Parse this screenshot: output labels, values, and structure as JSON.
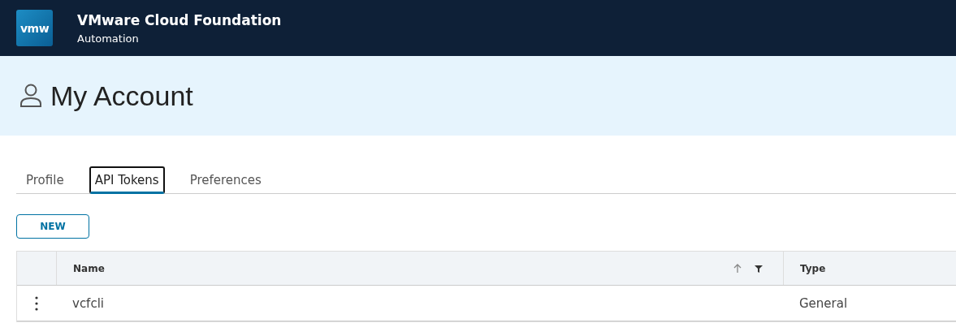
{
  "header": {
    "logo": "vmw",
    "title": "VMware Cloud Foundation",
    "subtitle": "Automation"
  },
  "page": {
    "title": "My Account"
  },
  "tabs": [
    {
      "label": "Profile",
      "selected": false
    },
    {
      "label": "API Tokens",
      "selected": true
    },
    {
      "label": "Preferences",
      "selected": false
    }
  ],
  "new_button": "NEW",
  "table": {
    "columns": [
      {
        "label": "Name",
        "sortable": true
      },
      {
        "label": "Type",
        "sortable": false
      }
    ],
    "rows": [
      {
        "cells": [
          "vcfcli",
          "General"
        ]
      }
    ]
  }
}
